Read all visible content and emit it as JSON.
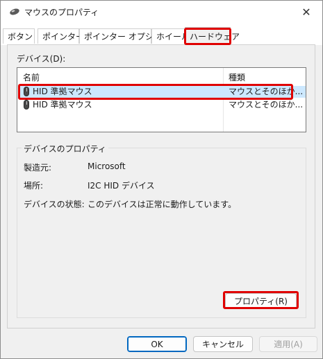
{
  "window": {
    "title": "マウスのプロパティ",
    "icon": "mouse-icon",
    "close_glyph": "✕"
  },
  "tabs": [
    {
      "label": "ボタン"
    },
    {
      "label": "ポインター"
    },
    {
      "label": "ポインター オプション"
    },
    {
      "label": "ホイール"
    },
    {
      "label": "ハードウェア",
      "selected": true
    }
  ],
  "devices": {
    "label": "デバイス(D):",
    "columns": [
      "名前",
      "種類"
    ],
    "rows": [
      {
        "name": "HID 準拠マウス",
        "type": "マウスとそのほか...",
        "selected": true
      },
      {
        "name": "HID 準拠マウス",
        "type": "マウスとそのほか...",
        "selected": false
      }
    ]
  },
  "properties": {
    "group_title": "デバイスのプロパティ",
    "items": [
      {
        "label": "製造元:",
        "value": "Microsoft"
      },
      {
        "label": "場所:",
        "value": "I2C HID デバイス"
      },
      {
        "label": "デバイスの状態:",
        "value": "このデバイスは正常に動作しています。"
      }
    ],
    "button": "プロパティ(R)"
  },
  "footer": {
    "ok": "OK",
    "cancel": "キャンセル",
    "apply": "適用(A)"
  },
  "colors": {
    "highlight": "#e00000",
    "selection": "#cce8ff",
    "accent": "#0067c0"
  }
}
